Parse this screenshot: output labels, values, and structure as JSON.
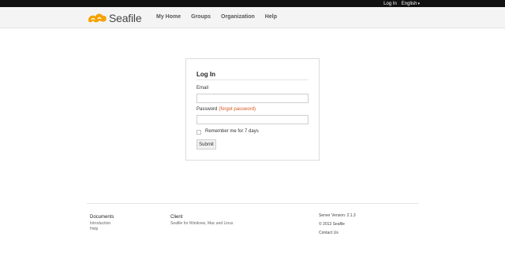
{
  "topbar": {
    "login": "Log In",
    "language": "English",
    "caret": "▾"
  },
  "header": {
    "logo_text": "Seafile",
    "nav": [
      "My Home",
      "Groups",
      "Organization",
      "Help"
    ]
  },
  "login": {
    "title": "Log In",
    "email_label": "Email",
    "email_value": "",
    "password_label": "Password",
    "forgot": "(forgot password)",
    "password_value": "",
    "remember": "Remember me for 7 days",
    "submit": "Submit"
  },
  "footer": {
    "documents": {
      "heading": "Documents",
      "links": [
        "Introduction",
        "Help"
      ]
    },
    "client": {
      "heading": "Client",
      "links": [
        "Seafile for Windows, Mac and Linux"
      ]
    },
    "server": {
      "version": "Server Version: 2.1.3",
      "copyright": "© 2013 Seafile",
      "contact": "Contact Us"
    }
  },
  "colors": {
    "brand_orange": "#f5a300",
    "link_orange": "#d9541e",
    "topbar": "#111111"
  }
}
